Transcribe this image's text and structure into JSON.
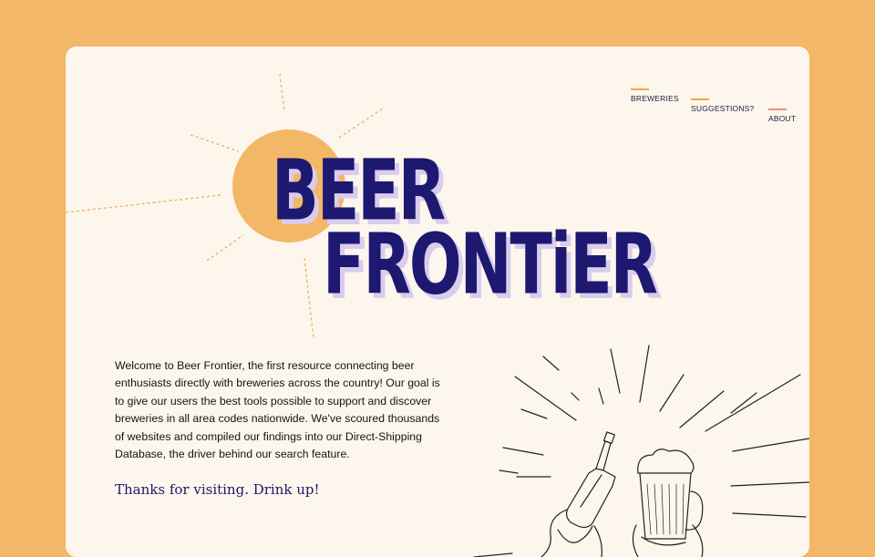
{
  "nav": {
    "items": [
      {
        "label": "BREWERIES",
        "accent": "#f0a94a"
      },
      {
        "label": "SUGGESTIONS?",
        "accent": "#f0a94a"
      },
      {
        "label": "ABOUT",
        "accent": "#f08c7a"
      }
    ]
  },
  "logo": {
    "line1": "BEER",
    "line2": "FRONTiER"
  },
  "intro": "Welcome to Beer Frontier, the first resource connecting beer enthusiasts directly with breweries across the country! Our goal is to give our users the best tools possible to support and discover breweries in all area codes nationwide. We've scoured thousands of websites and compiled our findings into our Direct-Shipping Database, the driver behind our search feature.",
  "tagline": "Thanks for visiting. Drink up!",
  "colors": {
    "page_bg": "#f2b767",
    "card_bg": "#fdf6ec",
    "brand": "#1d1870",
    "sun": "#f2b767"
  },
  "icons": {
    "sun": "sun-icon",
    "illustration": "beer-toast-illustration"
  }
}
